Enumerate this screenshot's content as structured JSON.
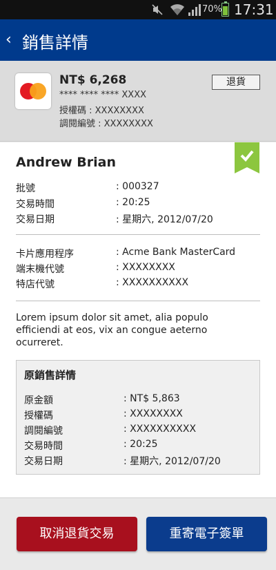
{
  "status_bar": {
    "battery_percent": "70%",
    "time": "17:31",
    "battery_level": 0.7
  },
  "header": {
    "title": "銷售詳情",
    "back_glyph": "‹"
  },
  "summary": {
    "card_brand": "MasterCard",
    "amount": "NT$ 6,268",
    "card_number": "**** **** **** XXXX",
    "auth_code": "授權碼 : XXXXXXXX",
    "ref_number": "調閱編號 : XXXXXXXX",
    "refund_label": "退貨"
  },
  "details": {
    "customer_name": "Andrew Brian",
    "rows_group1": [
      {
        "label": "批號",
        "value": ": 000327"
      },
      {
        "label": "交易時間",
        "value": ": 20:25"
      },
      {
        "label": "交易日期",
        "value": ": 星期六, 2012/07/20"
      }
    ],
    "rows_group2": [
      {
        "label": "卡片應用程序",
        "value": ": Acme Bank MasterCard"
      },
      {
        "label": "端末機代號",
        "value": ": XXXXXXXX"
      },
      {
        "label": "特店代號",
        "value": ": XXXXXXXXXX"
      }
    ],
    "description": "Lorem ipsum dolor sit amet, alia populo efficiendi at eos, vix an congue aeterno ocurreret."
  },
  "original_sale": {
    "title": "原銷售詳情",
    "rows": [
      {
        "label": "原金額",
        "value": ": NT$ 5,863"
      },
      {
        "label": "授權碼",
        "value": ": XXXXXXXX"
      },
      {
        "label": "調閱編號",
        "value": ": XXXXXXXXXX"
      },
      {
        "label": "交易時間",
        "value": ": 20:25"
      },
      {
        "label": "交易日期",
        "value": ": 星期六, 2012/07/20"
      }
    ]
  },
  "actions": {
    "cancel_label": "取消退貨交易",
    "resend_label": "重寄電子簽單"
  },
  "colors": {
    "header_bg": "#003a8c",
    "cancel_bg": "#a8101e",
    "resend_bg": "#0b3c8d",
    "ribbon": "#8cc63f"
  }
}
